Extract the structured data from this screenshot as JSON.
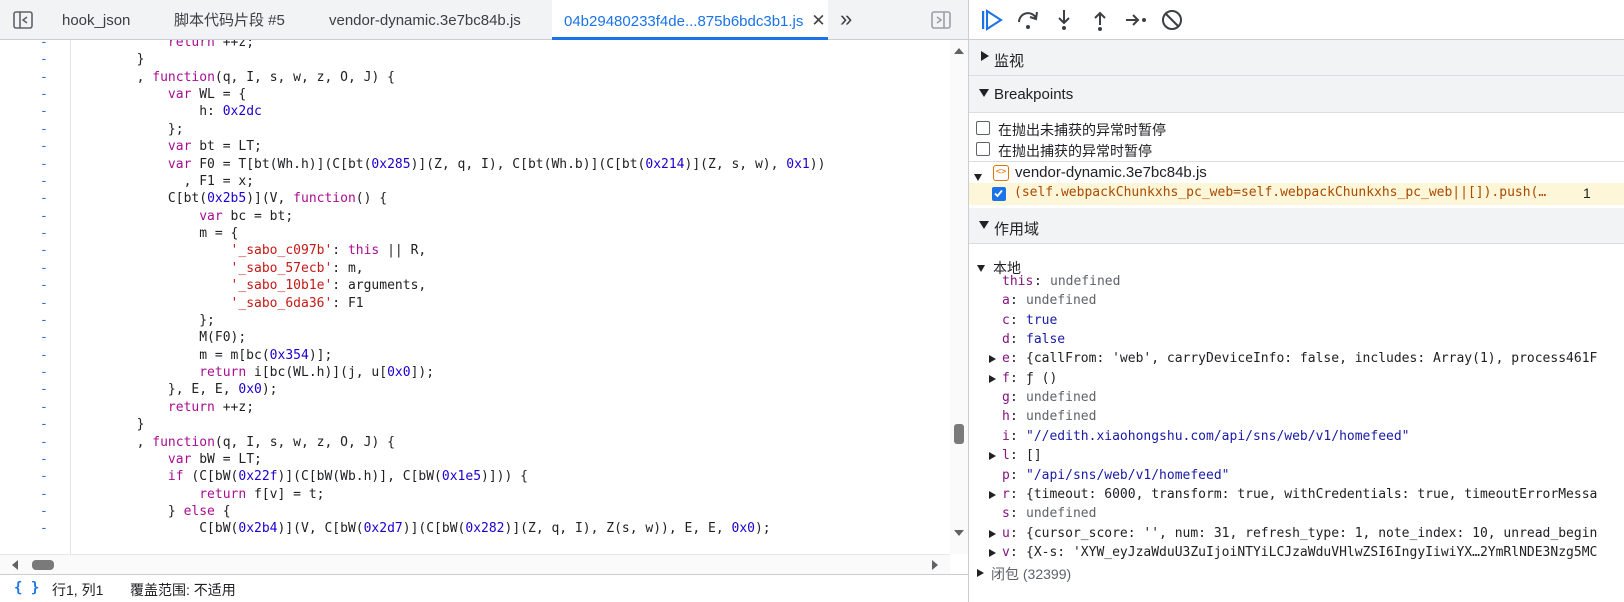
{
  "tabs": [
    {
      "label": "hook_json"
    },
    {
      "label": "脚本代码片段 #5"
    },
    {
      "label": "vendor-dynamic.3e7bc84b.js"
    },
    {
      "label": "04b29480233f4de...875b6bdc3b1.js",
      "active": true
    }
  ],
  "tab_close_glyph": "✕",
  "tab_more_glyph": "»",
  "code_lines": [
    {
      "text": "            return ++z;"
    },
    {
      "text": "        }"
    },
    {
      "text": "        , function(q, I, s, w, z, O, J) {"
    },
    {
      "text": "            var WL = {"
    },
    {
      "text": "                h: 0x2dc"
    },
    {
      "text": "            };"
    },
    {
      "text": "            var bt = LT;"
    },
    {
      "text": "            var F0 = T[bt(Wh.h)](C[bt(0x285)](Z, q, I), C[bt(Wh.b)](C[bt(0x214)](Z, s, w), 0x1))"
    },
    {
      "text": "              , F1 = x;"
    },
    {
      "text": "            C[bt(0x2b5)](V, function() {"
    },
    {
      "text": "                var bc = bt;"
    },
    {
      "text": "                m = {"
    },
    {
      "text": "                    '_sabo_c097b': this || R,"
    },
    {
      "text": "                    '_sabo_57ecb': m,"
    },
    {
      "text": "                    '_sabo_10b1e': arguments,"
    },
    {
      "text": "                    '_sabo_6da36': F1"
    },
    {
      "text": "                };"
    },
    {
      "text": "                M(F0);"
    },
    {
      "text": "                m = m[bc(0x354)];"
    },
    {
      "text": "                return i[bc(WL.h)](j, u[0x0]);"
    },
    {
      "text": "            }, E, E, 0x0);"
    },
    {
      "text": "            return ++z;"
    },
    {
      "text": "        }"
    },
    {
      "text": "        , function(q, I, s, w, z, O, J) {"
    },
    {
      "text": "            var bW = LT;"
    },
    {
      "text": "            if (C[bW(0x22f)](C[bW(Wb.h)], C[bW(0x1e5)])) {"
    },
    {
      "text": "                return f[v] = t;"
    },
    {
      "text": "            } else {"
    },
    {
      "text": "                C[bW(0x2b4)](V, C[bW(0x2d7)](C[bW(0x282)](Z, q, I), Z(s, w)), E, E, 0x0);"
    }
  ],
  "gutter_marker": "-",
  "status": {
    "braces": "{ }",
    "position": "行1, 列1",
    "coverage": "覆盖范围: 不适用"
  },
  "watch": {
    "title": "监视"
  },
  "breakpoints": {
    "title": "Breakpoints",
    "uncaught": "在抛出未捕获的异常时暂停",
    "caught": "在抛出捕获的异常时暂停",
    "file": "vendor-dynamic.3e7bc84b.js",
    "bp_code": "(self.webpackChunkxhs_pc_web=self.webpackChunkxhs_pc_web||[]).push(…",
    "bp_line": "1"
  },
  "scope": {
    "title": "作用域",
    "local_title": "本地",
    "vars": [
      {
        "name": "this",
        "value": "undefined",
        "kind": "undef",
        "expand": false
      },
      {
        "name": "a",
        "value": "undefined",
        "kind": "undef",
        "expand": false
      },
      {
        "name": "c",
        "value": "true",
        "kind": "bool",
        "expand": false
      },
      {
        "name": "d",
        "value": "false",
        "kind": "bool",
        "expand": false
      },
      {
        "name": "e",
        "value": "{callFrom: 'web', carryDeviceInfo: false, includes: Array(1), process461F",
        "kind": "obj",
        "expand": true
      },
      {
        "name": "f",
        "value": "ƒ ()",
        "kind": "obj",
        "expand": true
      },
      {
        "name": "g",
        "value": "undefined",
        "kind": "undef",
        "expand": false
      },
      {
        "name": "h",
        "value": "undefined",
        "kind": "undef",
        "expand": false
      },
      {
        "name": "i",
        "value": "\"//edith.xiaohongshu.com/api/sns/web/v1/homefeed\"",
        "kind": "str",
        "expand": false
      },
      {
        "name": "l",
        "value": "[]",
        "kind": "obj",
        "expand": true
      },
      {
        "name": "p",
        "value": "\"/api/sns/web/v1/homefeed\"",
        "kind": "str",
        "expand": false
      },
      {
        "name": "r",
        "value": "{timeout: 6000, transform: true, withCredentials: true, timeoutErrorMessa",
        "kind": "obj",
        "expand": true
      },
      {
        "name": "s",
        "value": "undefined",
        "kind": "undef",
        "expand": false
      },
      {
        "name": "u",
        "value": "{cursor_score: '', num: 31, refresh_type: 1, note_index: 10, unread_begin",
        "kind": "obj",
        "expand": true
      },
      {
        "name": "v",
        "value": "{X-s: 'XYW_eyJzaWduU3ZuIjoiNTYiLCJzaWduVHlwZSI6IngyIiwiYX…2YmRlNDE3Nzg5MC",
        "kind": "obj",
        "expand": true
      }
    ],
    "closure": "闭包 (32399)"
  },
  "colors": {
    "accent": "#1a73e8",
    "bp_highlight": "#fdf6d8",
    "gutter": "#3367d6"
  }
}
